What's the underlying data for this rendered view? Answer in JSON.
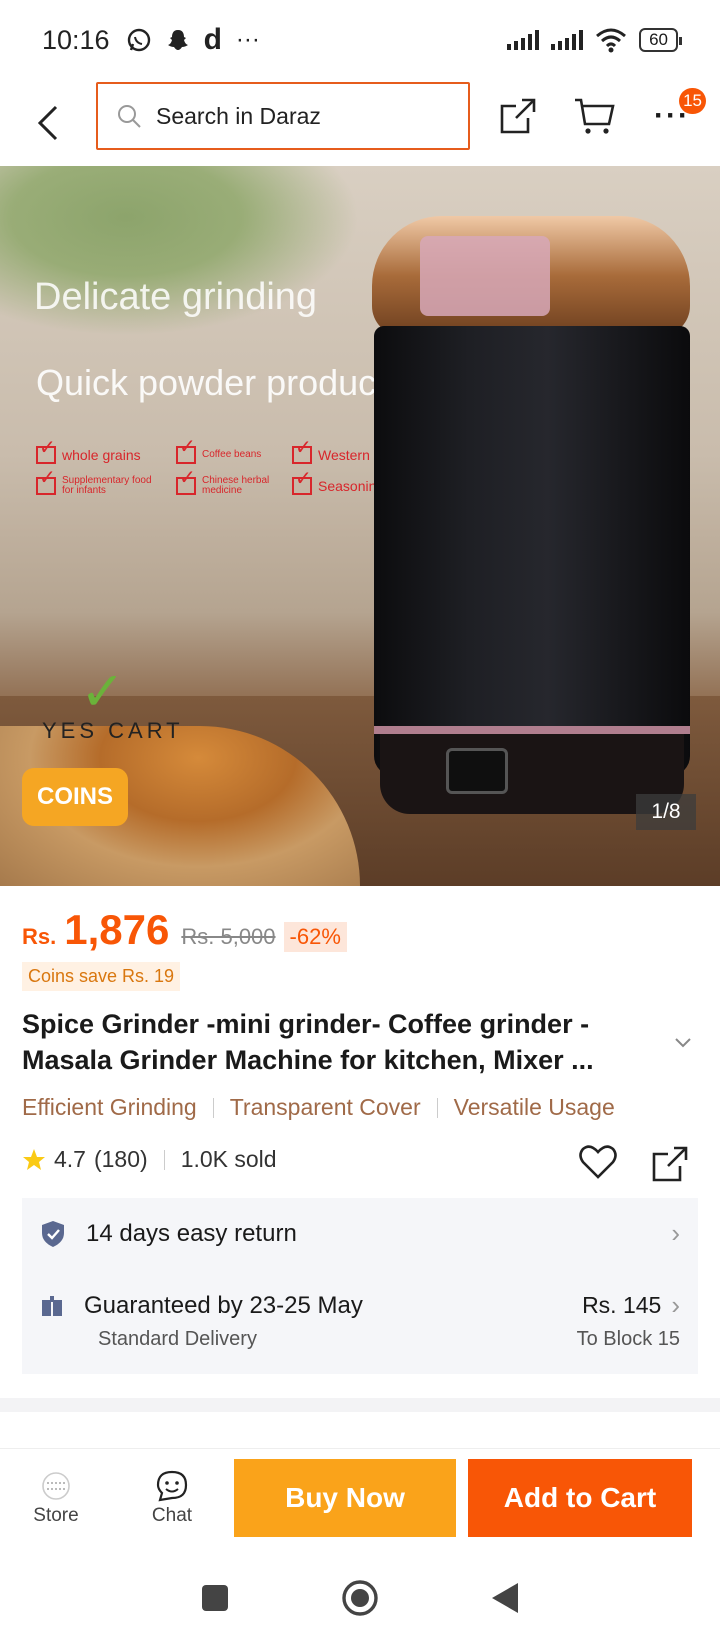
{
  "status_bar": {
    "time": "10:16",
    "app_letter": "d",
    "more": "···",
    "battery": "60"
  },
  "nav": {
    "search_placeholder": "Search in Daraz",
    "more_label": "···",
    "badge_count": "15"
  },
  "hero": {
    "line1": "Delicate grinding",
    "line2": "Quick powder production",
    "features": [
      "whole grains",
      "Coffee beans",
      "Western medicine",
      "Supplementary food for infants",
      "Chinese herbal medicine",
      "Seasoning"
    ],
    "yes_cart": "YES CART",
    "coins_label": "COINS",
    "page_counter": "1/8"
  },
  "price": {
    "currency": "Rs.",
    "current": "1,876",
    "original": "Rs. 5,000",
    "discount": "-62%",
    "coins_save": "Coins save Rs. 19"
  },
  "product": {
    "title": "Spice Grinder -mini grinder- Coffee grinder - Masala Grinder Machine for kitchen, Mixer ...",
    "tags": [
      "Efficient Grinding",
      "Transparent Cover",
      "Versatile Usage"
    ],
    "rating": "4.7",
    "review_count": "(180)",
    "sold": "1.0K sold"
  },
  "service": {
    "return_text": "14 days easy return",
    "delivery_text": "Guaranteed by 23-25 May",
    "delivery_type": "Standard Delivery",
    "fee": "Rs. 145",
    "location": "To Block 15"
  },
  "actions": {
    "store": "Store",
    "chat": "Chat",
    "buy_now": "Buy Now",
    "add_to_cart": "Add to Cart"
  },
  "colors": {
    "accent": "#f85606",
    "buy": "#faa31a",
    "coins": "#f5a623"
  }
}
